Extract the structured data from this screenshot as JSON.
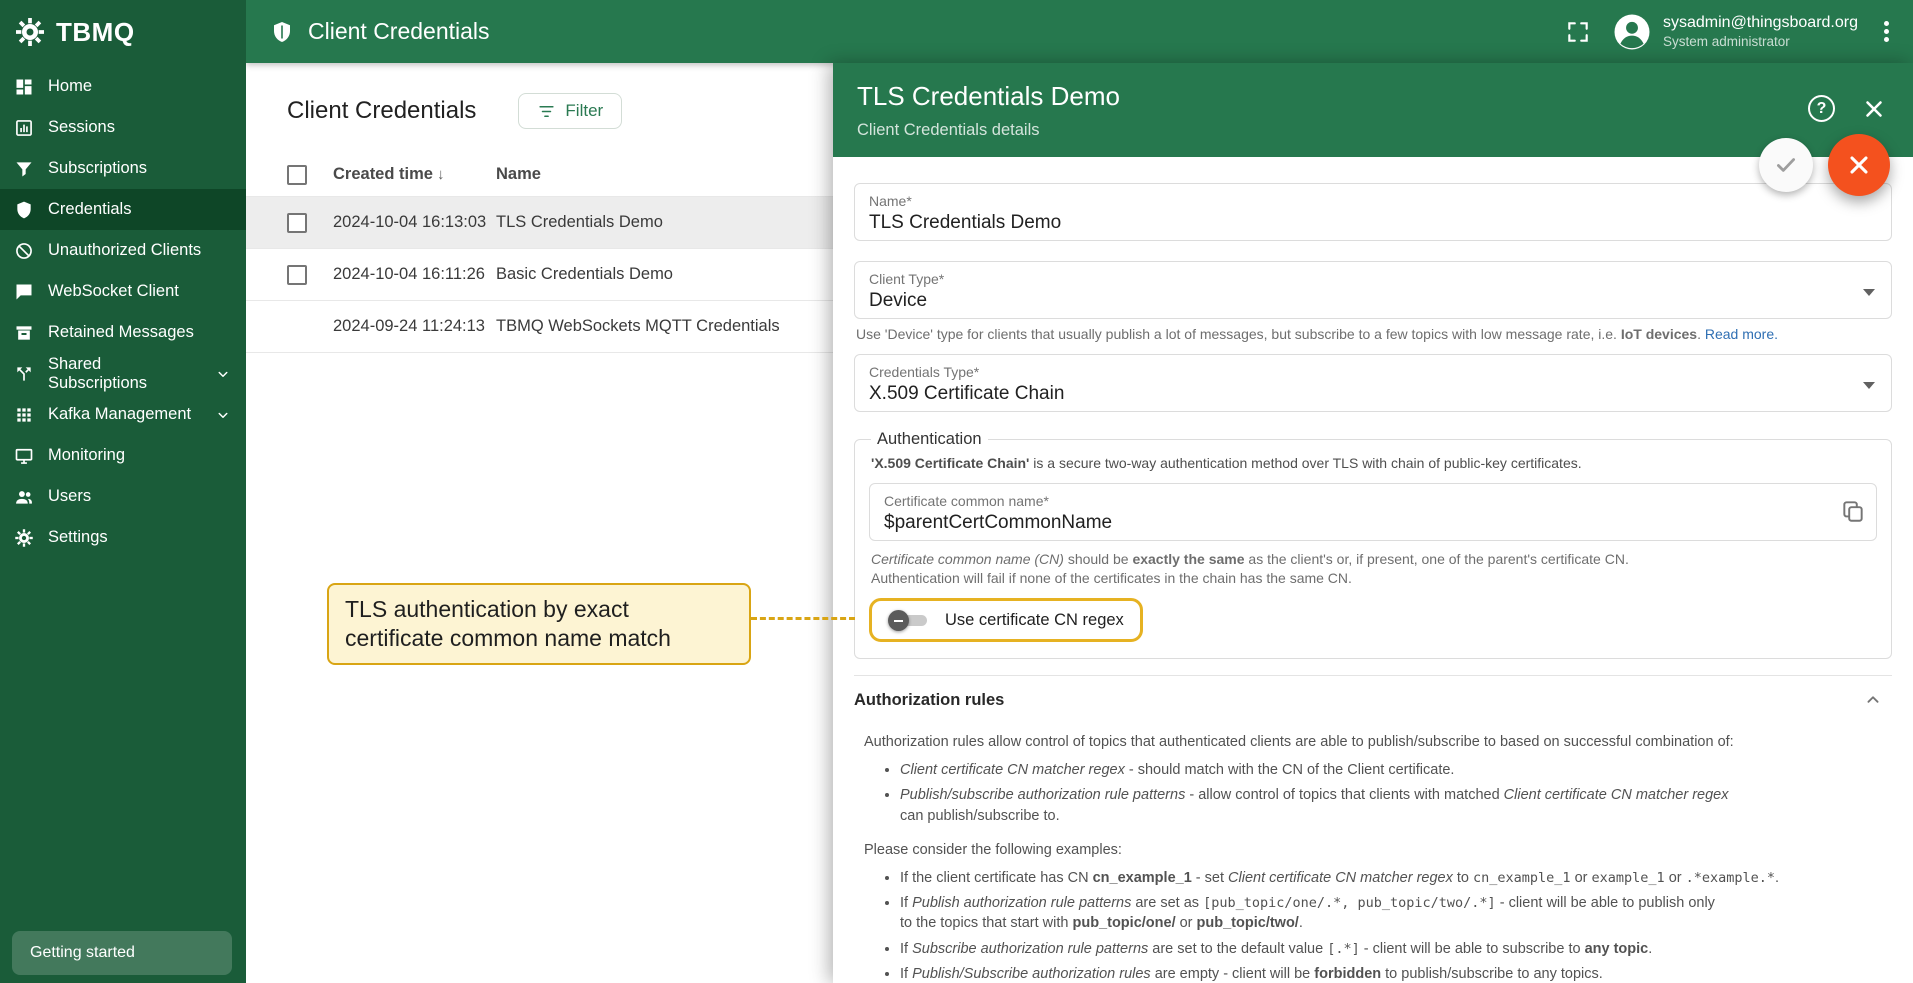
{
  "colors": {
    "sidebar_bg": "#1a5c39",
    "header_bg": "#26784e",
    "active_item_bg": "#0e4627",
    "fab_orange": "#f4511e",
    "annotation_yellow": "#d9a514",
    "link_blue": "#2f6fb3",
    "selected_row_bg": "#ededed"
  },
  "icons_text": {
    "sort_desc": "↓",
    "help": "?"
  },
  "sidebar": {
    "logo": "TBMQ",
    "items": [
      {
        "label": "Home",
        "icon": "home-icon",
        "active": false,
        "expandable": false
      },
      {
        "label": "Sessions",
        "icon": "sessions-icon",
        "active": false,
        "expandable": false
      },
      {
        "label": "Subscriptions",
        "icon": "subscriptions-icon",
        "active": false,
        "expandable": false
      },
      {
        "label": "Credentials",
        "icon": "credentials-icon",
        "active": true,
        "expandable": false
      },
      {
        "label": "Unauthorized Clients",
        "icon": "unauthorized-icon",
        "active": false,
        "expandable": false
      },
      {
        "label": "WebSocket Client",
        "icon": "websocket-icon",
        "active": false,
        "expandable": false
      },
      {
        "label": "Retained Messages",
        "icon": "retained-icon",
        "active": false,
        "expandable": false
      },
      {
        "label": "Shared Subscriptions",
        "icon": "shared-subscriptions-icon",
        "active": false,
        "expandable": true
      },
      {
        "label": "Kafka Management",
        "icon": "kafka-icon",
        "active": false,
        "expandable": true
      },
      {
        "label": "Monitoring",
        "icon": "monitoring-icon",
        "active": false,
        "expandable": false
      },
      {
        "label": "Users",
        "icon": "users-icon",
        "active": false,
        "expandable": false
      },
      {
        "label": "Settings",
        "icon": "settings-icon",
        "active": false,
        "expandable": false
      }
    ],
    "getting_started": "Getting started"
  },
  "header": {
    "title": "Client Credentials",
    "account": {
      "email": "sysadmin@thingsboard.org",
      "role": "System administrator"
    }
  },
  "list": {
    "title": "Client Credentials",
    "filter_label": "Filter",
    "columns": {
      "created_time": "Created time",
      "name": "Name"
    },
    "rows": [
      {
        "created_time": "2024-10-04 16:13:03",
        "name": "TLS Credentials Demo",
        "selected": true,
        "has_checkbox": true
      },
      {
        "created_time": "2024-10-04 16:11:26",
        "name": "Basic Credentials Demo",
        "selected": false,
        "has_checkbox": true
      },
      {
        "created_time": "2024-09-24 11:24:13",
        "name": "TBMQ WebSockets MQTT Credentials",
        "selected": false,
        "has_checkbox": false
      }
    ]
  },
  "annotation": {
    "text": "TLS authentication by exact certificate common name match"
  },
  "panel": {
    "title": "TLS Credentials Demo",
    "subtitle": "Client Credentials details",
    "fields": {
      "name": {
        "label": "Name*",
        "value": "TLS Credentials Demo"
      },
      "client_type": {
        "label": "Client Type*",
        "value": "Device",
        "hint": [
          {
            "t": "Use 'Device' type for clients that usually publish a lot of messages, but subscribe to a few topics with low message rate, i.e. "
          },
          {
            "t": "IoT devices",
            "s": "b"
          },
          {
            "t": ". "
          },
          {
            "t": "Read more.",
            "s": "link"
          }
        ]
      },
      "credentials_type": {
        "label": "Credentials Type*",
        "value": "X.509 Certificate Chain"
      }
    },
    "authentication": {
      "legend": "Authentication",
      "description": [
        {
          "t": "'X.509 Certificate Chain'",
          "s": "b"
        },
        {
          "t": " is a secure two-way authentication method over TLS with chain of public-key certificates."
        }
      ],
      "cn": {
        "label": "Certificate common name*",
        "value": "$parentCertCommonName"
      },
      "cn_hint_1": [
        {
          "t": "Certificate common name (CN)",
          "s": "i"
        },
        {
          "t": " should be "
        },
        {
          "t": "exactly the same",
          "s": "b"
        },
        {
          "t": " as the client's or, if present, one of the parent's certificate CN."
        }
      ],
      "cn_hint_2": "Authentication will fail if none of the certificates in the chain has the same CN.",
      "toggle_label": "Use certificate CN regex",
      "toggle_state": "off"
    },
    "authorization": {
      "title": "Authorization rules",
      "intro": "Authorization rules allow control of topics that authenticated clients are able to publish/subscribe to based on successful combination of:",
      "rules": [
        [
          {
            "t": "Client certificate CN matcher regex",
            "s": "i"
          },
          {
            "t": " - should match with the CN of the Client certificate."
          }
        ],
        [
          {
            "t": "Publish/subscribe authorization rule patterns",
            "s": "i"
          },
          {
            "t": " - allow control of topics that clients with matched "
          },
          {
            "t": "Client certificate CN matcher regex",
            "s": "i"
          },
          {
            "s": "br"
          },
          {
            "t": "can publish/subscribe to."
          }
        ]
      ],
      "examples_intro": "Please consider the following examples:",
      "examples": [
        [
          {
            "t": "If the client certificate has CN "
          },
          {
            "t": "cn_example_1",
            "s": "b"
          },
          {
            "t": " - set "
          },
          {
            "t": "Client certificate CN matcher regex",
            "s": "i"
          },
          {
            "t": " to "
          },
          {
            "t": "cn_example_1",
            "s": "c"
          },
          {
            "t": " or "
          },
          {
            "t": "example_1",
            "s": "c"
          },
          {
            "t": " or "
          },
          {
            "t": ".*example.*",
            "s": "c"
          },
          {
            "t": "."
          }
        ],
        [
          {
            "t": "If "
          },
          {
            "t": "Publish authorization rule patterns",
            "s": "i"
          },
          {
            "t": " are set as "
          },
          {
            "t": "[pub_topic/one/.*, pub_topic/two/.*]",
            "s": "c"
          },
          {
            "t": " - client will be able to publish only"
          },
          {
            "s": "br"
          },
          {
            "t": "to the topics that start with "
          },
          {
            "t": "pub_topic/one/",
            "s": "b"
          },
          {
            "t": " or "
          },
          {
            "t": "pub_topic/two/",
            "s": "b"
          },
          {
            "t": "."
          }
        ],
        [
          {
            "t": "If "
          },
          {
            "t": "Subscribe authorization rule patterns",
            "s": "i"
          },
          {
            "t": " are set to the default value "
          },
          {
            "t": "[.*]",
            "s": "c"
          },
          {
            "t": " - client will be able to subscribe to "
          },
          {
            "t": "any topic",
            "s": "b"
          },
          {
            "t": "."
          }
        ],
        [
          {
            "t": "If "
          },
          {
            "t": "Publish/Subscribe authorization rules",
            "s": "i"
          },
          {
            "t": " are empty - client will be "
          },
          {
            "t": "forbidden",
            "s": "b"
          },
          {
            "t": " to publish/subscribe to any topics."
          }
        ]
      ]
    }
  }
}
